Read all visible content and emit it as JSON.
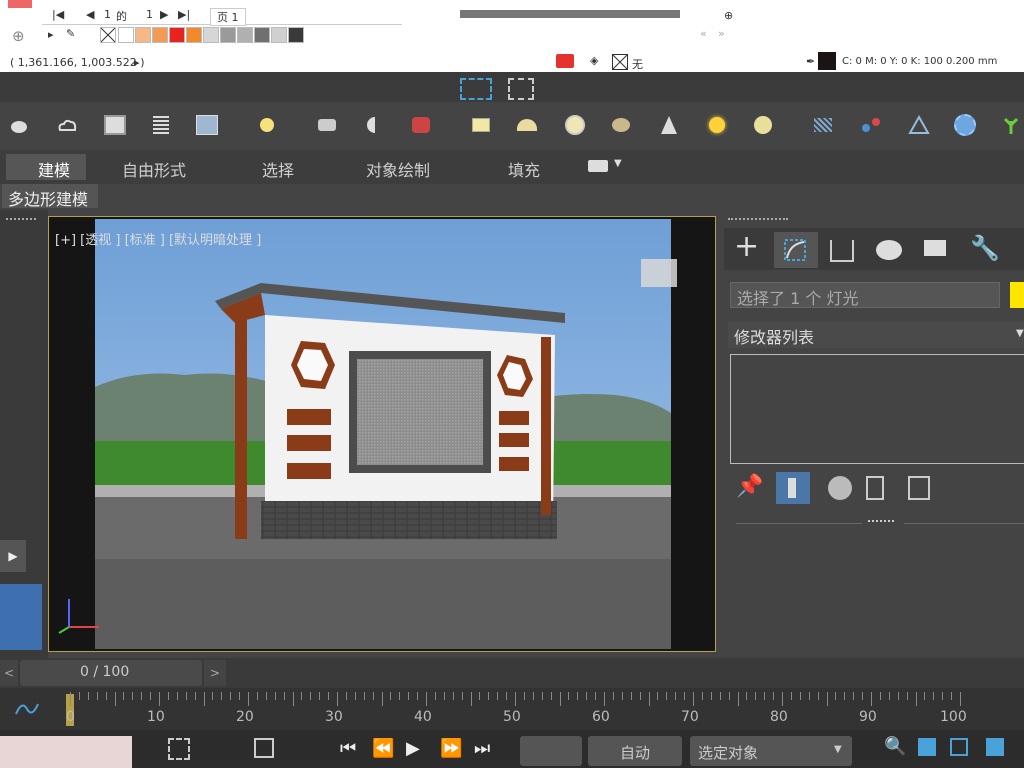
{
  "corel": {
    "page_nav": {
      "current": "1",
      "sep": "的",
      "total": "1",
      "tab": "页 1"
    },
    "coords": "( 1,361.166, 1,003.522 )",
    "fill_none": "无",
    "status_color": "C: 0 M: 0 Y: 0 K: 100  0.200 mm",
    "palette": [
      "#ffffff",
      "#f6b985",
      "#f39a54",
      "#e8221f",
      "#f28a2b",
      "#d6d6d6",
      "#9a9a9a",
      "#b0b0b0",
      "#707070",
      "#d0d0d0",
      "#3a3a3a"
    ]
  },
  "max": {
    "ribbon_tabs": [
      "建模",
      "自由形式",
      "选择",
      "对象绘制",
      "填充"
    ],
    "sub_label": "多边形建模",
    "viewport_label": "[+] [透视 ] [标准 ] [默认明暗处理 ]",
    "cmd": {
      "selection": "选择了 1 个 灯光",
      "modifier_list": "修改器列表"
    },
    "time": {
      "counter": "0 / 100",
      "prev": "<",
      "next": ">"
    },
    "track_ticks": [
      "0",
      "10",
      "20",
      "30",
      "40",
      "50",
      "60",
      "70",
      "80",
      "90",
      "100"
    ],
    "bottom": {
      "auto": "自动",
      "select_object": "选定对象"
    }
  }
}
